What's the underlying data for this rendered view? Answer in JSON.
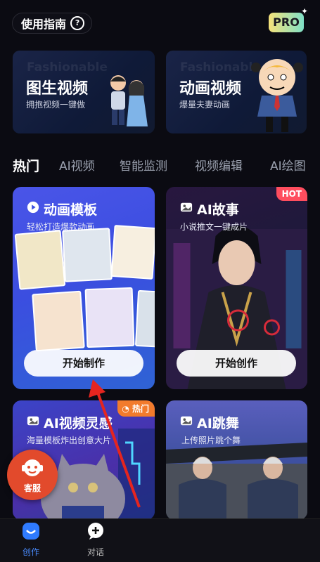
{
  "header": {
    "guide_label": "使用指南",
    "pro_label": "PRO"
  },
  "banners": [
    {
      "ghost": "Fashionable",
      "title": "图生视频",
      "subtitle": "拥抱视频一键做"
    },
    {
      "ghost": "Fashionable",
      "title": "动画视频",
      "subtitle": "爆量夫妻动画"
    }
  ],
  "tabs": [
    "热门",
    "AI视频",
    "智能监测",
    "视频编辑",
    "AI绘图"
  ],
  "cards": [
    {
      "title": "动画模板",
      "subtitle": "轻松打造爆款动画",
      "button": "开始制作"
    },
    {
      "title": "AI故事",
      "subtitle": "小说推文一键成片",
      "badge": "HOT",
      "button": "开始创作"
    },
    {
      "title": "AI视频灵感",
      "subtitle": "海量模板炸出创意大片",
      "badge": "热门"
    },
    {
      "title": "AI跳舞",
      "subtitle": "上传照片跳个舞"
    }
  ],
  "support": {
    "label": "客服"
  },
  "bottom_nav": [
    {
      "label": "创作",
      "active": true
    },
    {
      "label": "对话",
      "active": false
    }
  ],
  "colors": {
    "accent": "#4a8cff",
    "hot": "#ff4d5e",
    "fab": "#e24a2c",
    "pro_from": "#f6e27a",
    "pro_to": "#7fe0c7"
  }
}
